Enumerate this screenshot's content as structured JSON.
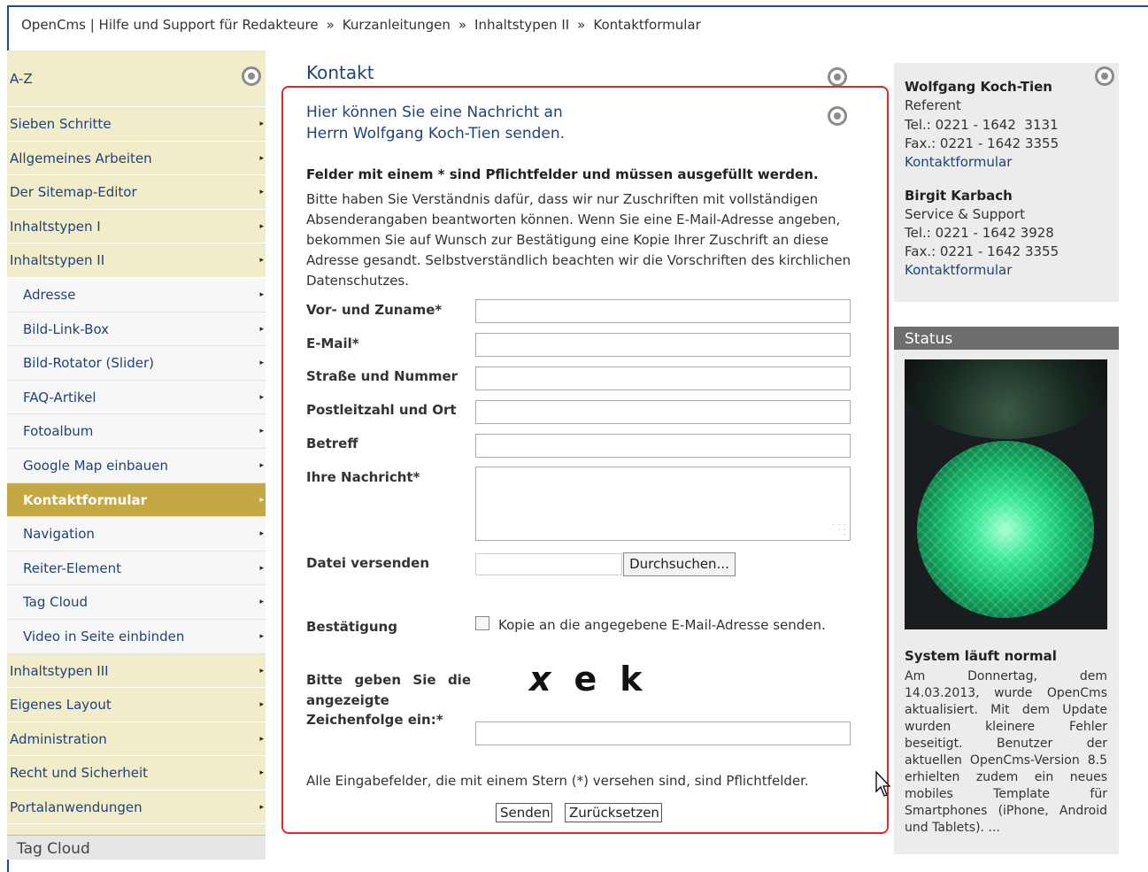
{
  "breadcrumb": [
    "OpenCms | Hilfe und Support für Redakteure",
    "Kurzanleitungen",
    "Inhaltstypen II",
    "Kontaktformular"
  ],
  "breadcrumb_sep": "»",
  "sidebar": {
    "top": [
      {
        "label": "A-Z"
      },
      {
        "label": "Sieben Schritte"
      },
      {
        "label": "Allgemeines Arbeiten"
      },
      {
        "label": "Der Sitemap-Editor"
      },
      {
        "label": "Inhaltstypen I"
      },
      {
        "label": "Inhaltstypen II"
      }
    ],
    "sub": [
      {
        "label": "Adresse"
      },
      {
        "label": "Bild-Link-Box"
      },
      {
        "label": "Bild-Rotator (Slider)"
      },
      {
        "label": "FAQ-Artikel"
      },
      {
        "label": "Fotoalbum"
      },
      {
        "label": "Google Map einbauen"
      },
      {
        "label": "Kontaktformular",
        "active": true
      },
      {
        "label": "Navigation"
      },
      {
        "label": "Reiter-Element"
      },
      {
        "label": "Tag Cloud"
      },
      {
        "label": "Video in Seite einbinden"
      }
    ],
    "bottom": [
      {
        "label": "Inhaltstypen III"
      },
      {
        "label": "Eigenes Layout"
      },
      {
        "label": "Administration"
      },
      {
        "label": "Recht und Sicherheit"
      },
      {
        "label": "Portalanwendungen"
      }
    ],
    "tag_cloud_title": "Tag Cloud",
    "arrow": "▸"
  },
  "main": {
    "title": "Kontakt",
    "intro_line1": "Hier können Sie eine Nachricht an",
    "intro_line2": "Herrn Wolfgang Koch-Tien senden.",
    "required_note": "Felder mit einem * sind Pflichtfelder und müssen ausgefüllt werden.",
    "explanation": "Bitte haben Sie Verständnis dafür, dass wir nur Zuschriften mit vollständigen Absenderangaben beantworten können. Wenn Sie eine E-Mail-Adresse angeben, bekommen Sie auf Wunsch zur Bestätigung eine Kopie Ihrer Zuschrift an diese Adresse gesandt. Selbstverständlich beachten wir die Vorschriften des kirchlichen Datenschutzes.",
    "fields": {
      "name": {
        "label": "Vor- und Zuname*",
        "value": ""
      },
      "email": {
        "label": "E-Mail*",
        "value": ""
      },
      "street": {
        "label": "Straße und Nummer",
        "value": ""
      },
      "city": {
        "label": "Postleitzahl und Ort",
        "value": ""
      },
      "subject": {
        "label": "Betreff",
        "value": ""
      },
      "message": {
        "label": "Ihre Nachricht*",
        "value": ""
      }
    },
    "file": {
      "label": "Datei versenden",
      "button": "Durchsuchen..."
    },
    "confirm": {
      "label": "Bestätigung",
      "checkbox_label": "Kopie an die angegebene E-Mail-Adresse senden.",
      "checked": false
    },
    "captcha": {
      "label_words": [
        "Bitte",
        "geben",
        "Sie",
        "die"
      ],
      "label_line2": "angezeigte",
      "label_line3": "Zeichenfolge ein:*",
      "chars": [
        "x",
        "e",
        "k"
      ],
      "value": ""
    },
    "footnote": "Alle Eingabefelder, die mit einem Stern (*) versehen sind, sind Pflichtfelder.",
    "send_button": "Senden",
    "reset_button": "Zurücksetzen"
  },
  "contacts": [
    {
      "name": "Wolfgang Koch-Tien",
      "role": "Referent",
      "tel": "Tel.: 0221 - 1642  3131",
      "fax": "Fax.: 0221 - 1642 3355",
      "link": "Kontaktformular"
    },
    {
      "name": "Birgit Karbach",
      "role": "Service & Support",
      "tel": "Tel.: 0221 - 1642 3928",
      "fax": "Fax.: 0221 - 1642 3355",
      "link": "Kontaktformular"
    }
  ],
  "status": {
    "header": "Status",
    "title": "System läuft normal",
    "text": "Am Donnertag, dem 14.03.2013, wurde OpenCms aktualisiert. Mit dem Update wurden kleinere Fehler beseitigt. Benutzer der aktuellen OpenCms-Version 8.5 erhielten zudem ein neues mobiles Template für Smartphones (iPhone, Android und Tablets). ..."
  },
  "colors": {
    "accent_red": "#e2262b",
    "link_blue": "#21427a",
    "nav_bg": "#f1ecc9",
    "nav_active": "#c4a843"
  }
}
